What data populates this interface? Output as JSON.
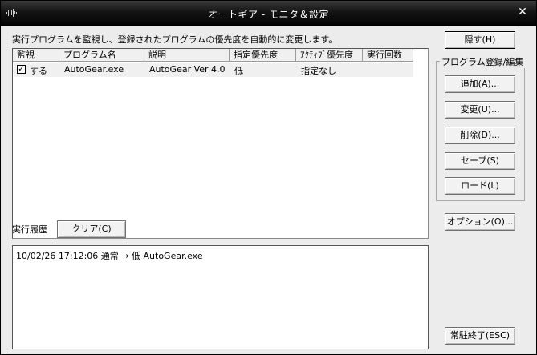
{
  "window": {
    "title": "オートギア - モニタ＆設定",
    "close_glyph": "✕"
  },
  "main": {
    "description": "実行プログラムを監視し、登録されたプログラムの優先度を自動的に変更します。"
  },
  "list": {
    "columns": [
      "監視",
      "プログラム名",
      "説明",
      "指定優先度",
      "ｱｸﾃｨﾌﾞ優先度",
      "実行回数"
    ],
    "rows": [
      {
        "checked_glyph": "✓",
        "monitor": "する",
        "program": "AutoGear.exe",
        "description": "AutoGear Ver 4.0",
        "priority": "低",
        "active_priority": "指定なし",
        "count": ""
      }
    ]
  },
  "history": {
    "label": "実行履歴",
    "clear_button": "クリア(C)",
    "lines": [
      "10/02/26 17:12:06 通常 → 低 AutoGear.exe"
    ]
  },
  "sidebar": {
    "hide_button": "隠す(H)",
    "group_label": "プログラム登録/編集",
    "add_button": "追加(A)...",
    "change_button": "変更(U)...",
    "delete_button": "削除(D)...",
    "save_button": "セーブ(S)",
    "load_button": "ロード(L)",
    "options_button": "オプション(O)...",
    "exit_button": "常駐終了(ESC)"
  }
}
